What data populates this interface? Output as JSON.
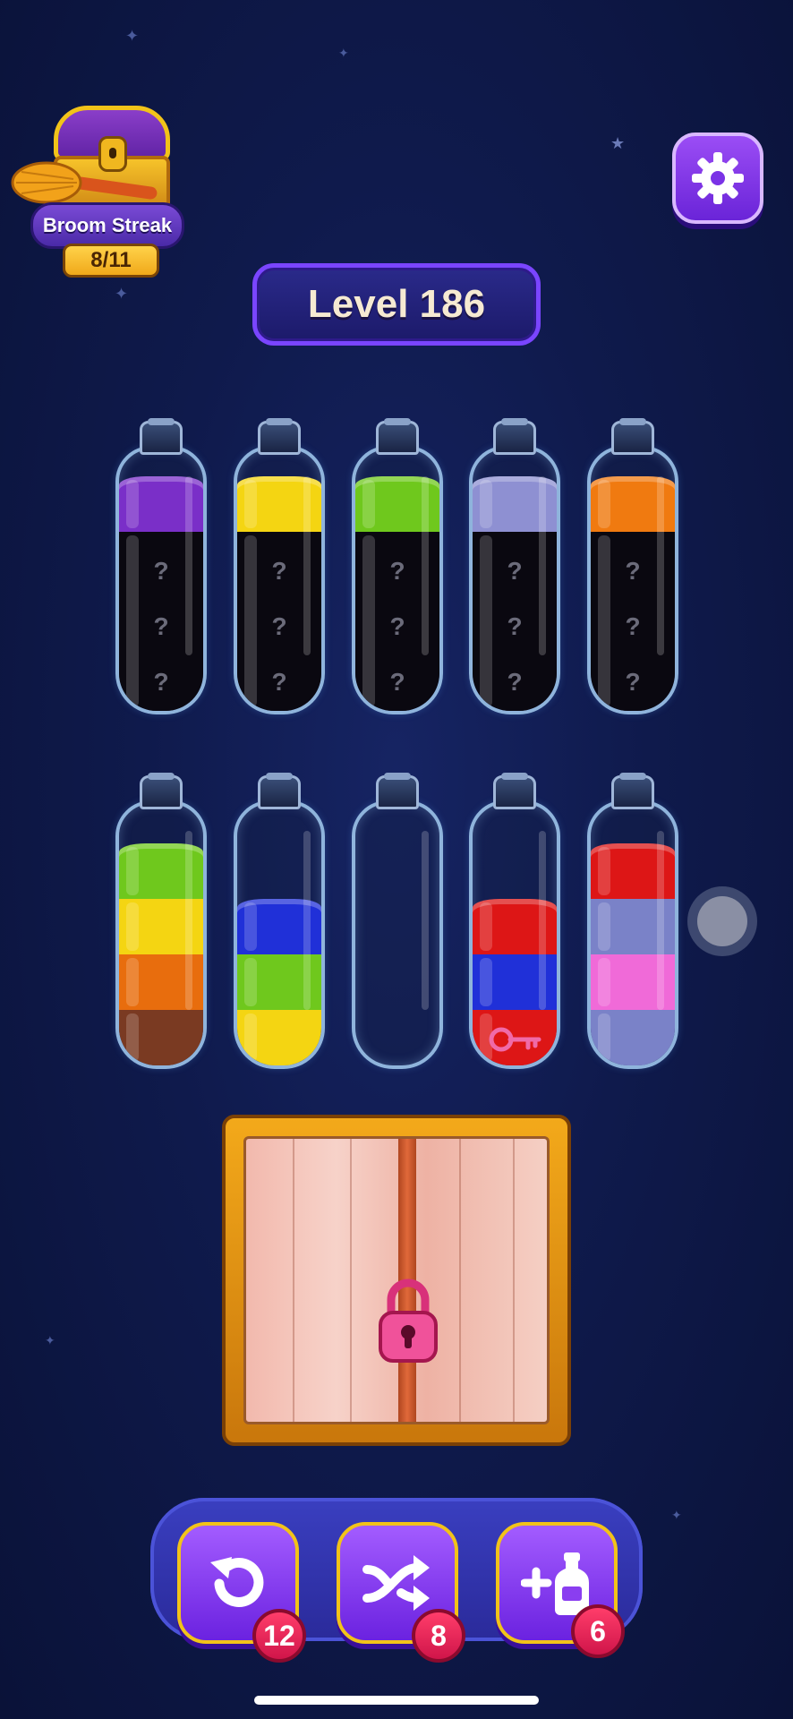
{
  "streak": {
    "label": "Broom Streak",
    "count": "8/11"
  },
  "level": {
    "label": "Level 186"
  },
  "icons": {
    "settings": "gear-icon",
    "undo": "undo-arrow-icon",
    "shuffle": "shuffle-arrows-icon",
    "add_bottle": "plus-bottle-icon",
    "lock": "padlock-icon",
    "key": "key-icon",
    "chest": "treasure-chest-icon",
    "broom": "broom-icon"
  },
  "bottles": [
    {
      "layers": [
        "#7a2fc8"
      ],
      "hidden": 3
    },
    {
      "layers": [
        "#f4d512"
      ],
      "hidden": 3
    },
    {
      "layers": [
        "#6fc81d"
      ],
      "hidden": 3
    },
    {
      "layers": [
        "#8e90d2"
      ],
      "hidden": 3
    },
    {
      "layers": [
        "#f07a10"
      ],
      "hidden": 3
    },
    {
      "layers": [
        "#6fc81d",
        "#f4d512",
        "#e86d0d",
        "#7a3a22"
      ],
      "hidden": 0
    },
    {
      "layers": [
        "#2030d8",
        "#6fc81d",
        "#f4d512"
      ],
      "hidden": 0
    },
    {
      "layers": [],
      "hidden": 0
    },
    {
      "layers": [
        "#dd1616",
        "#2030d8",
        "#dd1616"
      ],
      "hidden": 0,
      "key": true
    },
    {
      "layers": [
        "#dd1616",
        "#7a82c8",
        "#f06ad8",
        "#7a82c8"
      ],
      "hidden": 0
    }
  ],
  "hidden_mark": "?",
  "boosters": [
    {
      "name": "undo",
      "count": "12"
    },
    {
      "name": "shuffle",
      "count": "8"
    },
    {
      "name": "add-bottle",
      "count": "6"
    }
  ],
  "colors": {
    "background": "#0f1a4c",
    "accent_purple": "#7a45ff",
    "gold": "#f2c319",
    "badge_red": "#e01d50"
  }
}
